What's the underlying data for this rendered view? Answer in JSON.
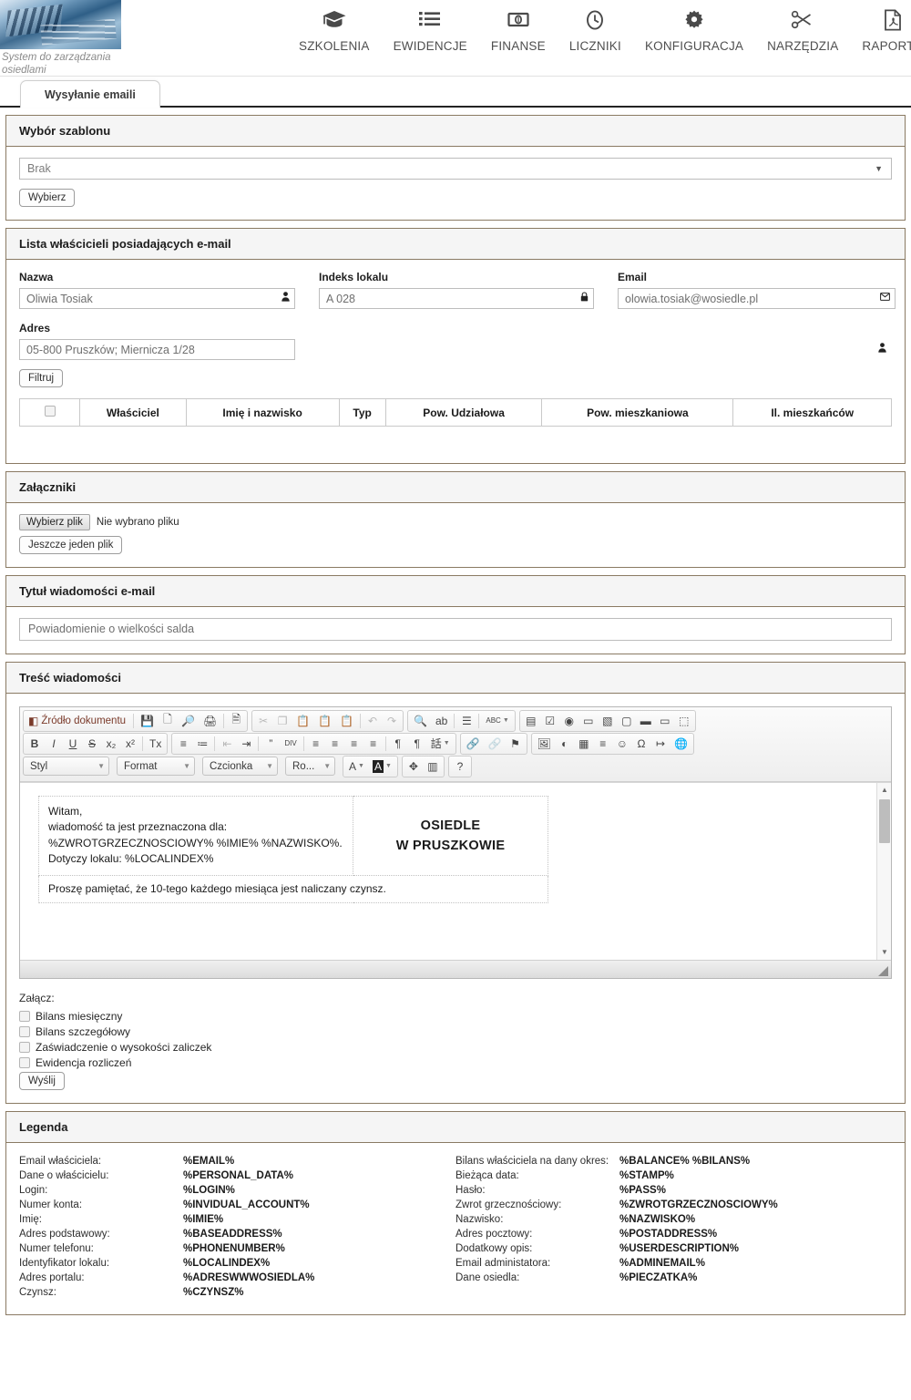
{
  "header": {
    "brand_subtitle": "System do zarządzania osiedlami",
    "nav": [
      {
        "label": "SZKOLENIA",
        "icon": "graduation-cap-icon"
      },
      {
        "label": "EWIDENCJE",
        "icon": "list-icon"
      },
      {
        "label": "FINANSE",
        "icon": "banknote-icon"
      },
      {
        "label": "LICZNIKI",
        "icon": "meter-clock-icon"
      },
      {
        "label": "KONFIGURACJA",
        "icon": "gear-icon"
      },
      {
        "label": "NARZĘDZIA",
        "icon": "scissors-icon"
      },
      {
        "label": "RAPORTY",
        "icon": "pdf-document-icon"
      }
    ]
  },
  "tab": {
    "label": "Wysyłanie emaili"
  },
  "template_panel": {
    "title": "Wybór szablonu",
    "select_value": "Brak",
    "button_label": "Wybierz"
  },
  "owners_panel": {
    "title": "Lista właścicieli posiadających e-mail",
    "fields": {
      "name_label": "Nazwa",
      "name_value": "Oliwia Tosiak",
      "name_icon": "person-icon",
      "index_label": "Indeks lokalu",
      "index_value": "A 028",
      "index_icon": "lock-icon",
      "email_label": "Email",
      "email_value": "olowia.tosiak@wosiedle.pl",
      "email_icon": "envelope-icon",
      "address_label": "Adres",
      "address_value": "05-800 Pruszków; Miernicza 1/28",
      "address_icon": "person-icon"
    },
    "filter_button": "Filtruj",
    "table_headers": [
      "",
      "Właściciel",
      "Imię i nazwisko",
      "Typ",
      "Pow. Udziałowa",
      "Pow. mieszkaniowa",
      "Il. mieszkańców"
    ]
  },
  "attachments_panel": {
    "title": "Załączniki",
    "choose_file_label": "Wybierz plik",
    "no_file_text": "Nie wybrano pliku",
    "another_file_label": "Jeszcze jeden plik"
  },
  "subject_panel": {
    "title": "Tytuł wiadomości e-mail",
    "value": "Powiadomienie o wielkości salda"
  },
  "body_panel": {
    "title": "Treść wiadomości",
    "toolbar": {
      "row1": [
        {
          "type": "group",
          "items": [
            {
              "name": "source-icon",
              "glyph": "◧",
              "label": "Źródło dokumentu",
              "style": "txt"
            },
            {
              "name": "sep"
            },
            {
              "name": "save-icon",
              "glyph": "💾"
            },
            {
              "name": "new-page-icon",
              "glyph": "🗋"
            },
            {
              "name": "preview-icon",
              "glyph": "🔎"
            },
            {
              "name": "print-icon",
              "glyph": "🖨"
            },
            {
              "name": "sep"
            },
            {
              "name": "templates-icon",
              "glyph": "🗎"
            }
          ]
        },
        {
          "type": "group",
          "items": [
            {
              "name": "cut-icon",
              "glyph": "✂",
              "dim": true
            },
            {
              "name": "copy-icon",
              "glyph": "❐",
              "dim": true
            },
            {
              "name": "paste-icon",
              "glyph": "📋"
            },
            {
              "name": "paste-text-icon",
              "glyph": "📋"
            },
            {
              "name": "paste-word-icon",
              "glyph": "📋"
            },
            {
              "name": "sep"
            },
            {
              "name": "undo-icon",
              "glyph": "↶",
              "dim": true
            },
            {
              "name": "redo-icon",
              "glyph": "↷",
              "dim": true
            }
          ]
        },
        {
          "type": "group",
          "items": [
            {
              "name": "find-icon",
              "glyph": "🔍"
            },
            {
              "name": "replace-icon",
              "glyph": "ab"
            },
            {
              "name": "sep"
            },
            {
              "name": "select-all-icon",
              "glyph": "☰"
            },
            {
              "name": "sep"
            },
            {
              "name": "spellcheck-icon",
              "glyph": "ABC",
              "caret": true
            }
          ]
        },
        {
          "type": "group",
          "items": [
            {
              "name": "form-icon",
              "glyph": "▤"
            },
            {
              "name": "checkbox-icon",
              "glyph": "☑"
            },
            {
              "name": "radio-icon",
              "glyph": "◉"
            },
            {
              "name": "text-field-icon",
              "glyph": "▭"
            },
            {
              "name": "textarea-icon",
              "glyph": "▧"
            },
            {
              "name": "select-field-icon",
              "glyph": "▢"
            },
            {
              "name": "button-icon",
              "glyph": "▬"
            },
            {
              "name": "image-button-icon",
              "glyph": "▭"
            },
            {
              "name": "hidden-field-icon",
              "glyph": "⬚"
            }
          ]
        }
      ],
      "row2": [
        {
          "type": "group",
          "items": [
            {
              "name": "bold-icon",
              "glyph": "B",
              "bold": true
            },
            {
              "name": "italic-icon",
              "glyph": "I",
              "italic": true
            },
            {
              "name": "underline-icon",
              "glyph": "U",
              "underline": true
            },
            {
              "name": "strike-icon",
              "glyph": "S",
              "strike": true
            },
            {
              "name": "subscript-icon",
              "glyph": "x₂"
            },
            {
              "name": "superscript-icon",
              "glyph": "x²"
            },
            {
              "name": "sep"
            },
            {
              "name": "remove-format-icon",
              "glyph": "Tx"
            }
          ]
        },
        {
          "type": "group",
          "items": [
            {
              "name": "numbered-list-icon",
              "glyph": "≡"
            },
            {
              "name": "bulleted-list-icon",
              "glyph": "≔"
            },
            {
              "name": "sep"
            },
            {
              "name": "outdent-icon",
              "glyph": "⇤",
              "dim": true
            },
            {
              "name": "indent-icon",
              "glyph": "⇥"
            },
            {
              "name": "sep"
            },
            {
              "name": "blockquote-icon",
              "glyph": "”"
            },
            {
              "name": "div-container-icon",
              "glyph": "DIV"
            },
            {
              "name": "sep"
            },
            {
              "name": "align-left-icon",
              "glyph": "≡"
            },
            {
              "name": "align-center-icon",
              "glyph": "≡"
            },
            {
              "name": "align-right-icon",
              "glyph": "≡"
            },
            {
              "name": "align-justify-icon",
              "glyph": "≡"
            },
            {
              "name": "sep"
            },
            {
              "name": "ltr-icon",
              "glyph": "¶"
            },
            {
              "name": "rtl-icon",
              "glyph": "¶"
            },
            {
              "name": "language-icon",
              "glyph": "話",
              "caret": true
            }
          ]
        },
        {
          "type": "group",
          "items": [
            {
              "name": "link-icon",
              "glyph": "🔗"
            },
            {
              "name": "unlink-icon",
              "glyph": "🔗",
              "dim": true
            },
            {
              "name": "anchor-icon",
              "glyph": "⚑"
            }
          ]
        },
        {
          "type": "group",
          "items": [
            {
              "name": "image-icon",
              "glyph": "🖼"
            },
            {
              "name": "flash-icon",
              "glyph": "◐"
            },
            {
              "name": "table-icon",
              "glyph": "▦"
            },
            {
              "name": "horizontal-rule-icon",
              "glyph": "≡"
            },
            {
              "name": "smiley-icon",
              "glyph": "☺"
            },
            {
              "name": "special-char-icon",
              "glyph": "Ω"
            },
            {
              "name": "page-break-icon",
              "glyph": "↦"
            },
            {
              "name": "iframe-icon",
              "glyph": "🌐"
            }
          ]
        }
      ],
      "combos": [
        {
          "name": "style-combo",
          "label": "Styl"
        },
        {
          "name": "format-combo",
          "label": "Format"
        },
        {
          "name": "font-combo",
          "label": "Czcionka"
        },
        {
          "name": "fontsize-combo",
          "label": "Ro..."
        }
      ],
      "row3_buttons": [
        {
          "name": "text-color-icon",
          "glyph": "A",
          "caret": true
        },
        {
          "name": "background-color-icon",
          "glyph": "A",
          "caret": true,
          "inverted": true
        },
        {
          "name": "maximize-icon",
          "glyph": "✥"
        },
        {
          "name": "show-blocks-icon",
          "glyph": "▥"
        },
        {
          "name": "about-icon",
          "glyph": "?"
        }
      ]
    },
    "content": {
      "line1": "Witam,",
      "line2": "wiadomość ta jest przeznaczona dla:",
      "line3": "%ZWROTGRZECZNOSCIOWY% %IMIE% %NAZWISKO%.",
      "line4": "Dotyczy lokalu: %LOCALINDEX%",
      "stamp_line1": "OSIEDLE",
      "stamp_line2": "W PRUSZKOWIE",
      "line5": "Proszę pamiętać, że 10-tego każdego miesiąca jest naliczany czynsz."
    },
    "attach_label": "Załącz:",
    "checkboxes": [
      "Bilans miesięczny",
      "Bilans szczegółowy",
      "Zaświadczenie o wysokości zaliczek",
      "Ewidencja rozliczeń"
    ],
    "send_button": "Wyślij"
  },
  "legend_panel": {
    "title": "Legenda",
    "left": [
      {
        "key": "Email właściciela:",
        "val": "%EMAIL%"
      },
      {
        "key": "Dane o właścicielu:",
        "val": "%PERSONAL_DATA%"
      },
      {
        "key": "Login:",
        "val": "%LOGIN%"
      },
      {
        "key": "Numer konta:",
        "val": "%INVIDUAL_ACCOUNT%"
      },
      {
        "key": "Imię:",
        "val": "%IMIE%"
      },
      {
        "key": "Adres podstawowy:",
        "val": "%BASEADDRESS%"
      },
      {
        "key": "Numer telefonu:",
        "val": "%PHONENUMBER%"
      },
      {
        "key": "Identyfikator lokalu:",
        "val": "%LOCALINDEX%"
      },
      {
        "key": "Adres portalu:",
        "val": "%ADRESWWWOSIEDLA%"
      },
      {
        "key": "Czynsz:",
        "val": "%CZYNSZ%"
      }
    ],
    "right": [
      {
        "key": "Bilans właściciela na dany okres:",
        "val": "%BALANCE% %BILANS%"
      },
      {
        "key": "Bieżąca data:",
        "val": "%STAMP%"
      },
      {
        "key": "Hasło:",
        "val": "%PASS%"
      },
      {
        "key": "Zwrot grzecznościowy:",
        "val": "%ZWROTGRZECZNOSCIOWY%"
      },
      {
        "key": "Nazwisko:",
        "val": "%NAZWISKO%"
      },
      {
        "key": "Adres pocztowy:",
        "val": "%POSTADDRESS%"
      },
      {
        "key": "Dodatkowy opis:",
        "val": "%USERDESCRIPTION%"
      },
      {
        "key": "Email administatora:",
        "val": "%ADMINEMAIL%"
      },
      {
        "key": "Dane osiedla:",
        "val": "%PIECZATKA%"
      }
    ]
  },
  "colors": {
    "panel_border": "#8a7a63",
    "head_bg": "#f5f5f5",
    "tab_border": "#232323"
  }
}
